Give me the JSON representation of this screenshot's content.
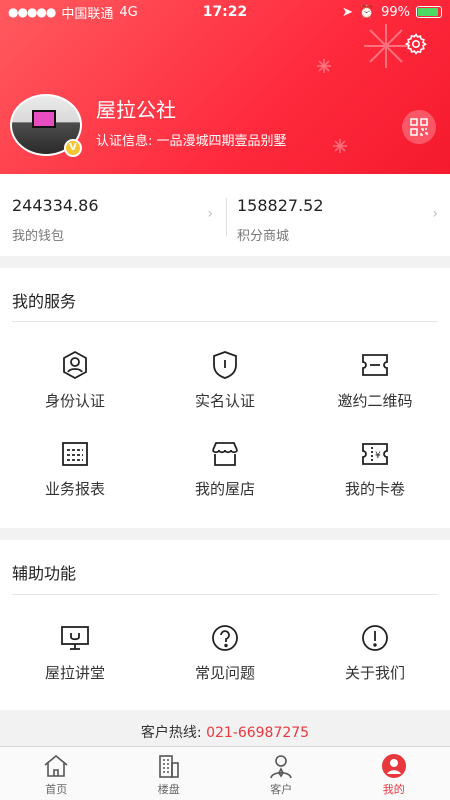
{
  "status_bar": {
    "signal_dots": "●●●●●",
    "carrier": "中国联通",
    "network": "4G",
    "time": "17:22",
    "battery": "99%"
  },
  "profile": {
    "name": "屋拉公社",
    "cert_label": "认证信息:",
    "cert_value": "一品漫城四期壹品别墅",
    "badge": "V"
  },
  "balances": [
    {
      "value": "244334.86",
      "label": "我的钱包"
    },
    {
      "value": "158827.52",
      "label": "积分商城"
    }
  ],
  "my_services": {
    "title": "我的服务",
    "items": [
      {
        "label": "身份认证",
        "icon": "identity-icon"
      },
      {
        "label": "实名认证",
        "icon": "shield-icon"
      },
      {
        "label": "邀约二维码",
        "icon": "ticket-icon"
      },
      {
        "label": "业务报表",
        "icon": "report-icon"
      },
      {
        "label": "我的屋店",
        "icon": "store-icon"
      },
      {
        "label": "我的卡卷",
        "icon": "coupon-icon"
      }
    ]
  },
  "aux_functions": {
    "title": "辅助功能",
    "items": [
      {
        "label": "屋拉讲堂",
        "icon": "monitor-icon"
      },
      {
        "label": "常见问题",
        "icon": "question-icon"
      },
      {
        "label": "关于我们",
        "icon": "exclamation-icon"
      }
    ]
  },
  "hotline": {
    "label": "客户热线:",
    "number": "021-66987275"
  },
  "tabbar": [
    {
      "label": "首页",
      "icon": "home-icon"
    },
    {
      "label": "楼盘",
      "icon": "building-icon"
    },
    {
      "label": "客户",
      "icon": "client-icon"
    },
    {
      "label": "我的",
      "icon": "user-icon",
      "active": true
    }
  ],
  "colors": {
    "brand_red": "#ff2a3d",
    "hotline_red": "#e8383d",
    "badge_gold": "#f7c531"
  }
}
